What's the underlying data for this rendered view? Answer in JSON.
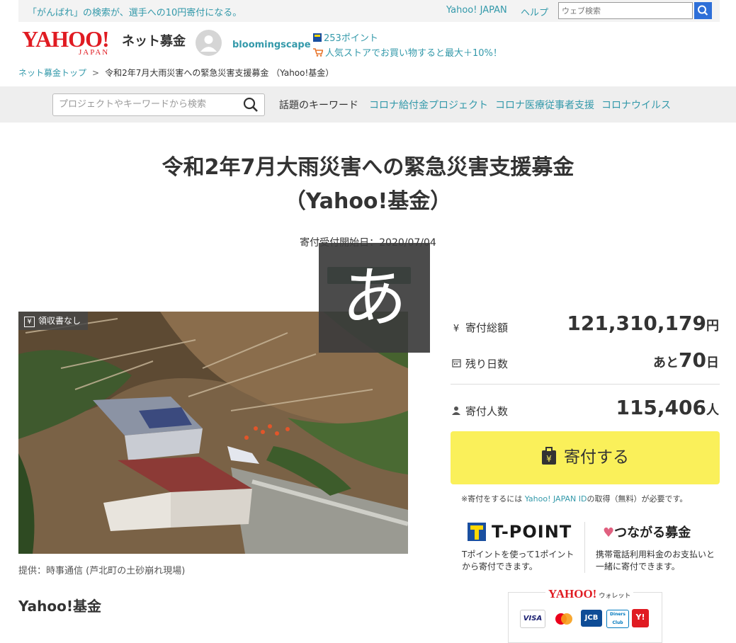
{
  "topbar": {
    "promo": "「がんばれ」の検索が、選手への10円寄付になる。",
    "yahoo_japan": "Yahoo! JAPAN",
    "help": "ヘルプ",
    "search_placeholder": "ウェブ検索"
  },
  "header": {
    "logo": "YAHOO!",
    "logo_sub": "JAPAN",
    "service": "ネット募金",
    "username": "bloomingscape",
    "points": "253ポイント",
    "promo": "人気ストアでお買い物すると最大＋10%！"
  },
  "breadcrumb": {
    "top": "ネット募金トップ",
    "separator": ">",
    "current": "令和2年7月大雨災害への緊急災害支援募金 （Yahoo!基金）"
  },
  "searchband": {
    "placeholder": "プロジェクトやキーワードから検索",
    "keywords_label": "話題のキーワード",
    "keywords": [
      "コロナ給付金プロジェクト",
      "コロナ医療従事者支援",
      "コロナウイルス"
    ]
  },
  "project": {
    "title_line1": "令和2年7月大雨災害への緊急災害支援募金",
    "title_line2": "（Yahoo!基金）",
    "start_date": "寄付受付開始日：2020/07/04",
    "receipt_badge": "領収書なし",
    "photo_caption": "提供：時事通信 (芦北町の土砂崩れ現場)",
    "organization": "Yahoo!基金"
  },
  "stats": {
    "total_label": "寄付総額",
    "total_value": "121,310,179",
    "total_unit": "円",
    "days_label": "残り日数",
    "days_prefix": "あと",
    "days_value": "70",
    "days_unit": "日",
    "donors_label": "寄付人数",
    "donors_value": "115,406",
    "donors_unit": "人"
  },
  "donate": {
    "button_label": "寄付する",
    "note_prefix": "※寄付をするには ",
    "note_link": "Yahoo! JAPAN ID",
    "note_suffix": "の取得（無料）が必要です。"
  },
  "payment": {
    "tpoint_logo": "T-POINT",
    "tpoint_desc": "Tポイントを使って1ポイントから寄付できます。",
    "tsunagaru_logo": "つながる募金",
    "tsunagaru_desc": "携帯電話利用料金のお支払いと一緒に寄付できます。",
    "wallet_logo": "YAHOO!",
    "wallet_sub": "ウォレット",
    "cards": [
      "VISA",
      "JCB",
      "Diners Club",
      "Y!"
    ]
  },
  "ime": {
    "char": "あ"
  },
  "colors": {
    "link": "#3399aa",
    "brand_red": "#e01b22",
    "donate_button": "#faf05a"
  }
}
